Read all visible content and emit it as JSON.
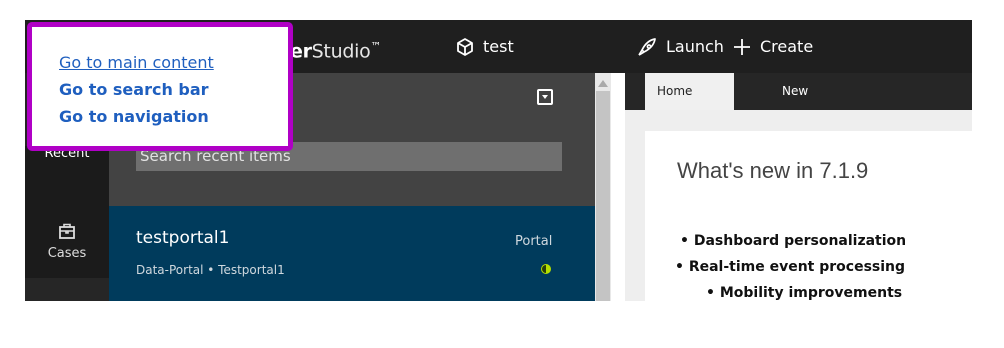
{
  "skip_links": {
    "main_content": "Go to main content",
    "search_bar": "Go to search bar",
    "navigation": "Go to navigation"
  },
  "header": {
    "brand_bold": "er",
    "brand_light": "Studio",
    "brand_tm": "™",
    "app_name": "test",
    "launch_label": "Launch",
    "create_label": "Create"
  },
  "nav": {
    "recent_label": "Recent",
    "cases_label": "Cases"
  },
  "recent_panel": {
    "search_placeholder": "Search recent items",
    "items": [
      {
        "title": "testportal1",
        "subtitle": "Data-Portal • Testportal1",
        "type": "Portal",
        "status_color": "#b6e000"
      }
    ]
  },
  "workarea": {
    "tabs": [
      "Home",
      "New"
    ],
    "heading": "What's new in 7.1.9",
    "bullets": [
      "• Dashboard personalization",
      "• Real-time event processing",
      "• Mobility improvements"
    ]
  },
  "colors": {
    "topbar": "#1f1f1f",
    "focus_outline": "#b000c6",
    "link": "#1f5fbf",
    "selected_item": "#003b5c"
  }
}
